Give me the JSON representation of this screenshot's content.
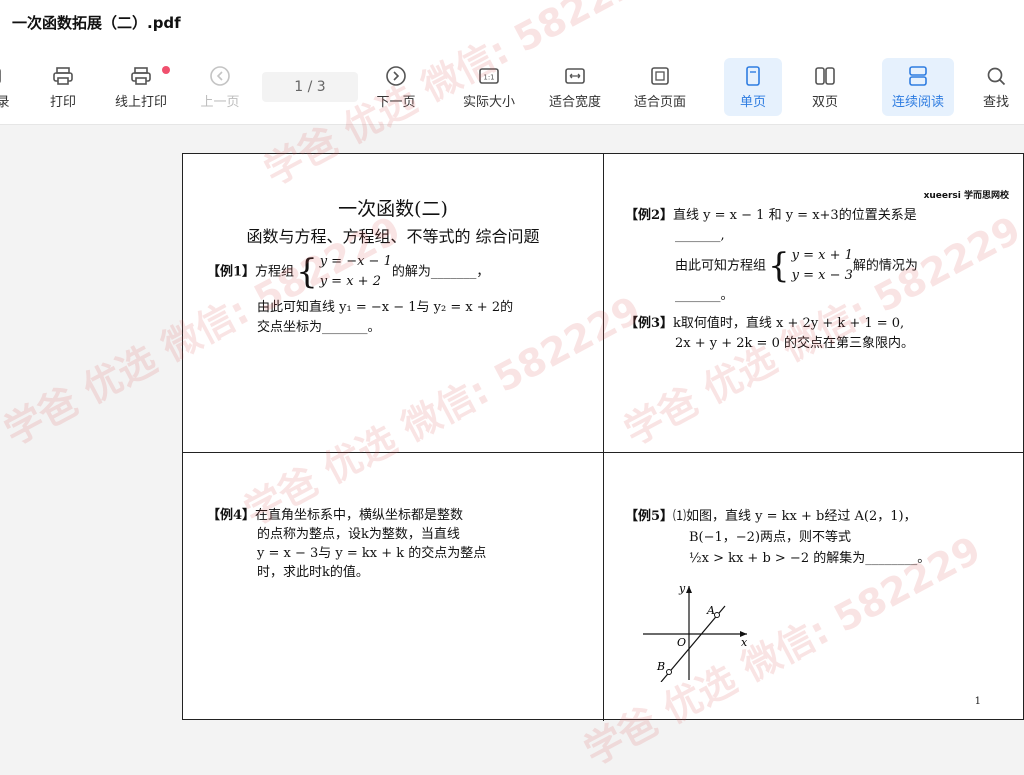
{
  "window": {
    "title": "一次函数拓展（二）.pdf"
  },
  "toolbar": {
    "items": [
      {
        "label": "录",
        "state": "normal"
      },
      {
        "label": "打印",
        "state": "normal"
      },
      {
        "label": "线上打印",
        "state": "normal"
      },
      {
        "label": "上一页",
        "state": "disabled"
      },
      {
        "label": "下一页",
        "state": "normal"
      },
      {
        "label": "实际大小",
        "state": "normal"
      },
      {
        "label": "适合宽度",
        "state": "normal"
      },
      {
        "label": "适合页面",
        "state": "normal"
      },
      {
        "label": "单页",
        "state": "active"
      },
      {
        "label": "双页",
        "state": "normal"
      },
      {
        "label": "连续阅读",
        "state": "active"
      },
      {
        "label": "查找",
        "state": "normal"
      }
    ],
    "page_indicator": "1 / 3",
    "actual_size_icon_text": "1:1"
  },
  "document": {
    "brand": "xueersi 学而思网校",
    "page_number": "1",
    "cell1": {
      "heading": "一次函数(二)",
      "subheading": "函数与方程、方程组、不等式的   综合问题",
      "ex1_label": "【例1】",
      "ex1_text_a": "方程组",
      "ex1_eq1": "y = −x − 1",
      "ex1_eq2": "y = x + 2",
      "ex1_text_b": "的解为_______，",
      "ex1_line2": "由此可知直线 y₁ = −x − 1与 y₂ = x + 2的",
      "ex1_line3": "交点坐标为_______。"
    },
    "cell2": {
      "ex2_label": "【例2】",
      "ex2_line1": "直线 y = x − 1 和 y = x+3的位置关系是",
      "ex2_line2": "_______,",
      "ex2_line3a": "由此可知方程组",
      "ex2_eq1": "y = x + 1",
      "ex2_eq2": "y = x − 3",
      "ex2_line3b": "解的情况为",
      "ex2_line4": "_______。",
      "ex3_label": "【例3】",
      "ex3_line1": "k取何值时，直线 x + 2y + k + 1 = 0,",
      "ex3_line2": "2x + y + 2k = 0 的交点在第三象限内。"
    },
    "cell3": {
      "ex4_label": "【例4】",
      "ex4_line1": "在直角坐标系中，横纵坐标都是整数",
      "ex4_line2": "的点称为整点，设k为整数，当直线",
      "ex4_line3": "y = x − 3与 y = kx + k 的交点为整点",
      "ex4_line4": "时，求此时k的值。"
    },
    "cell4": {
      "ex5_label": "【例5】",
      "ex5_line1": "⑴如图，直线 y = kx + b经过 A(2，1)，",
      "ex5_line2": "B(−1，−2)两点，则不等式",
      "ex5_line3": "½x > kx + b > −2 的解集为________。",
      "graph": {
        "y_label": "y",
        "x_label": "x",
        "origin_label": "O",
        "a_label": "A",
        "b_label": "B"
      }
    }
  },
  "watermark": {
    "text": "学爸 优选 微信: 582229"
  }
}
